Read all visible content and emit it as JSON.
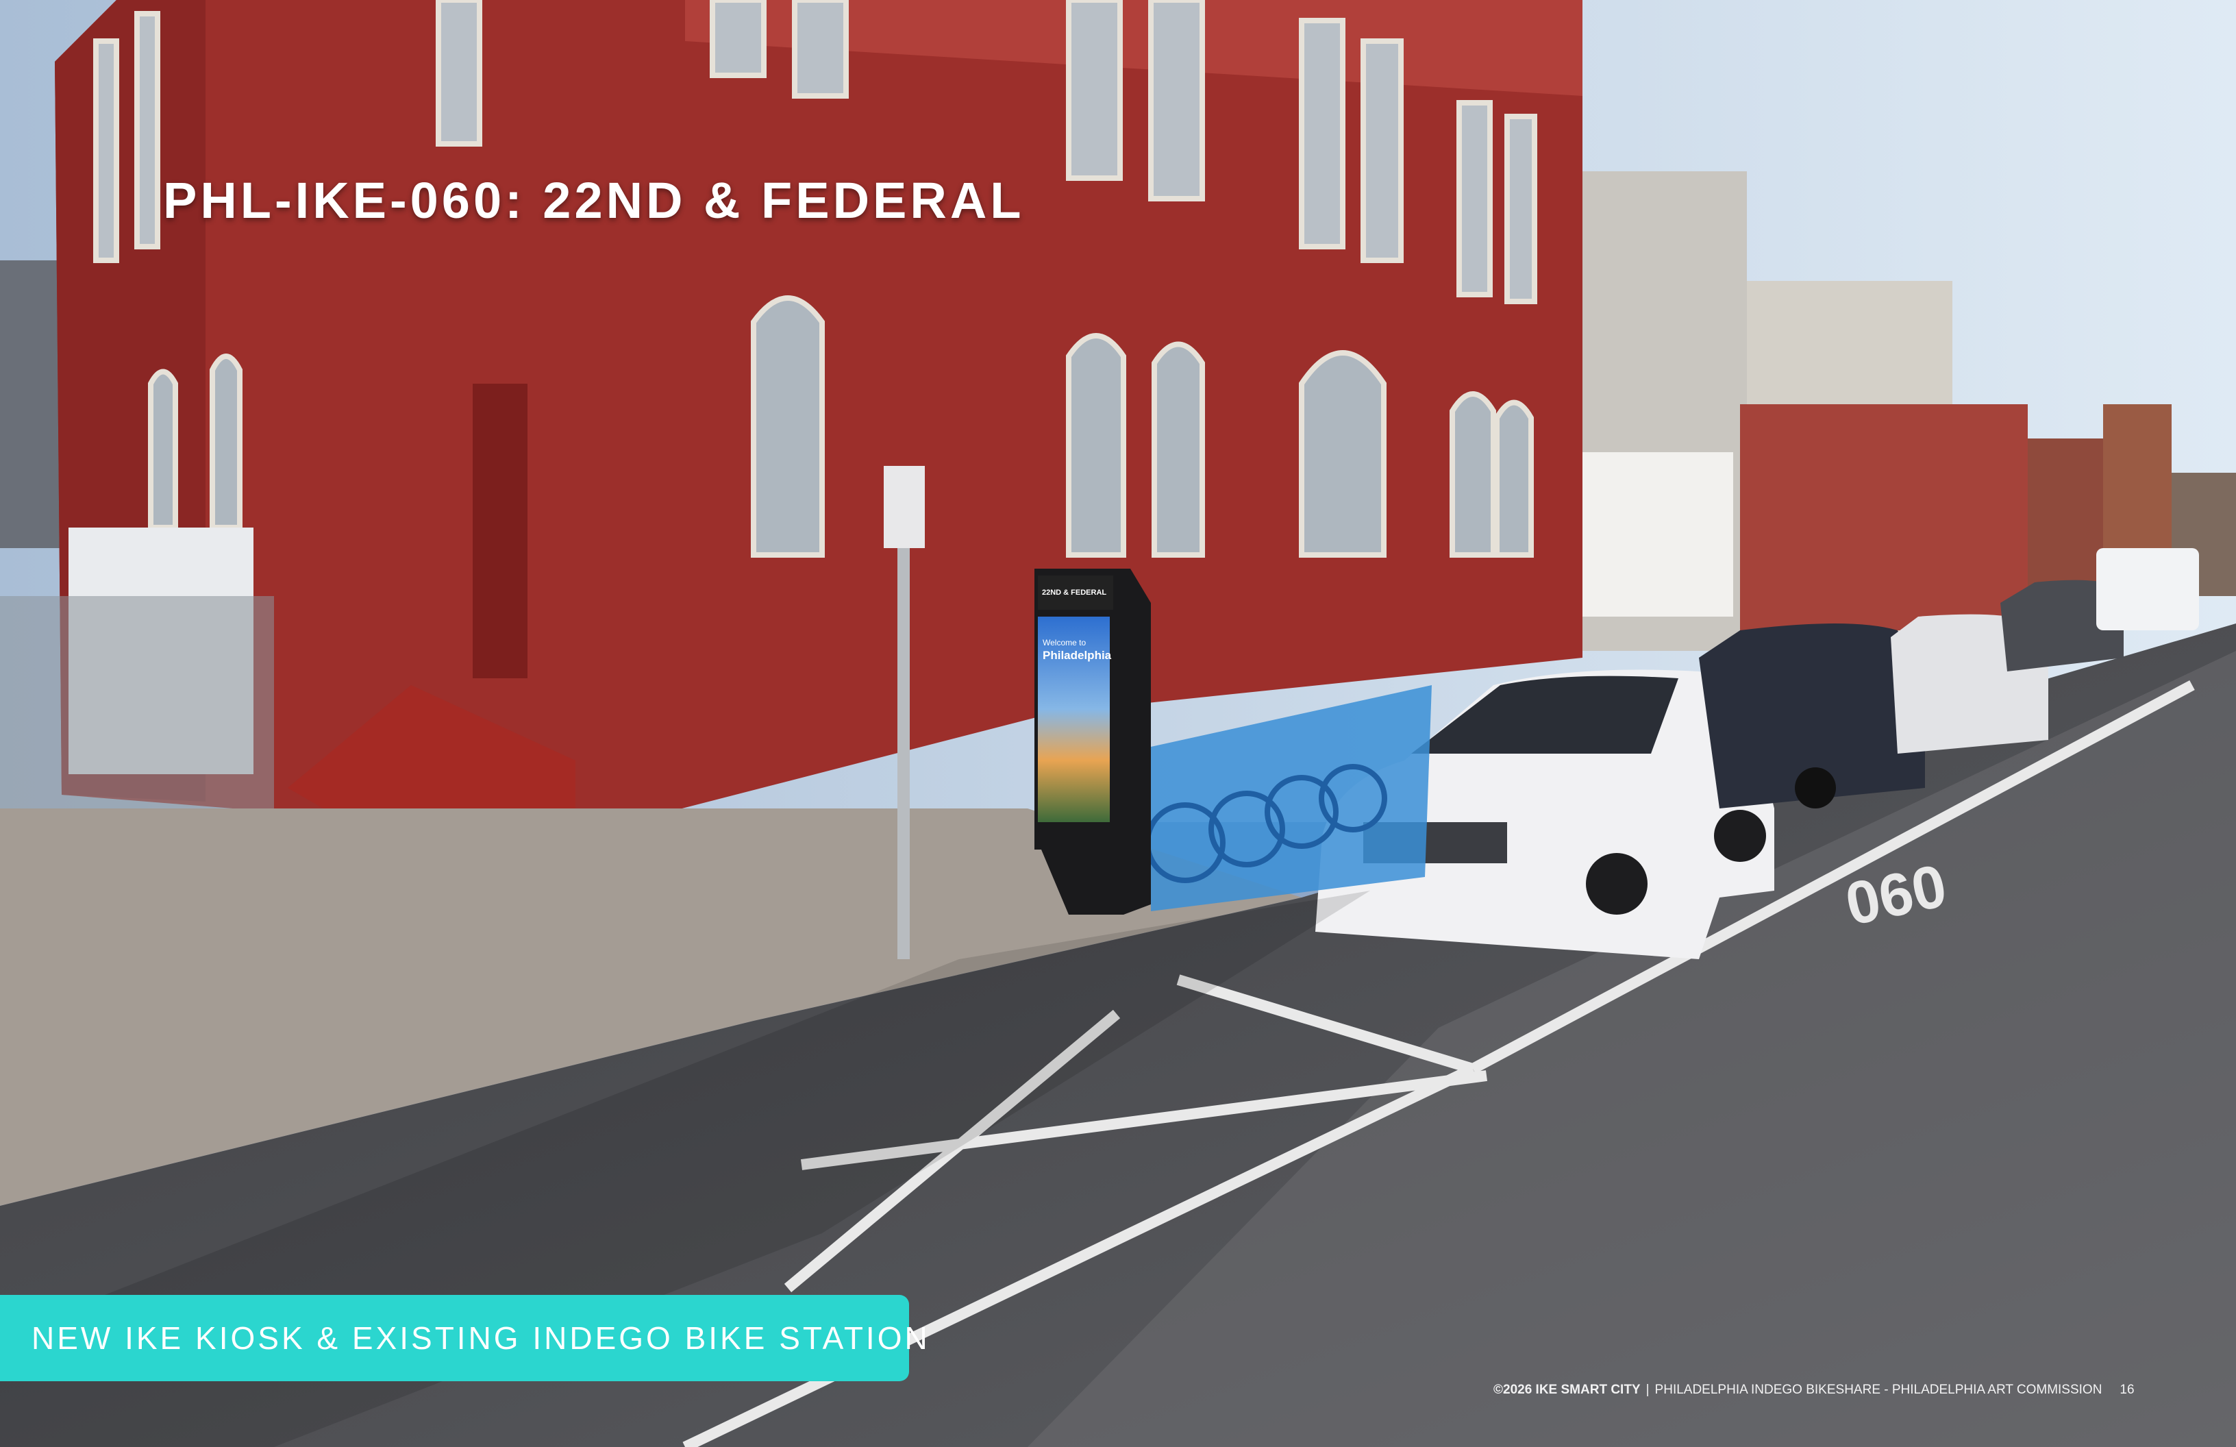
{
  "slide": {
    "title": "PHL-IKE-060: 22ND & FEDERAL",
    "caption": "NEW IKE KIOSK & EXISTING INDEGO BIKE STATION",
    "footer": {
      "copyright": "©2026 IKE SMART CITY",
      "separator": "|",
      "project": "PHILADELPHIA INDEGO BIKESHARE - PHILADELPHIA ART COMMISSION",
      "page_number": "16"
    }
  },
  "kiosk": {
    "location_label": "22ND & FEDERAL",
    "screen_heading": "Welcome to",
    "screen_title": "Philadelphia"
  },
  "road_marking": "060",
  "colors": {
    "caption_bg": "#2bd6cf",
    "building_brick": "#9c2f2b",
    "bike_blue": "#3b8fd6"
  }
}
